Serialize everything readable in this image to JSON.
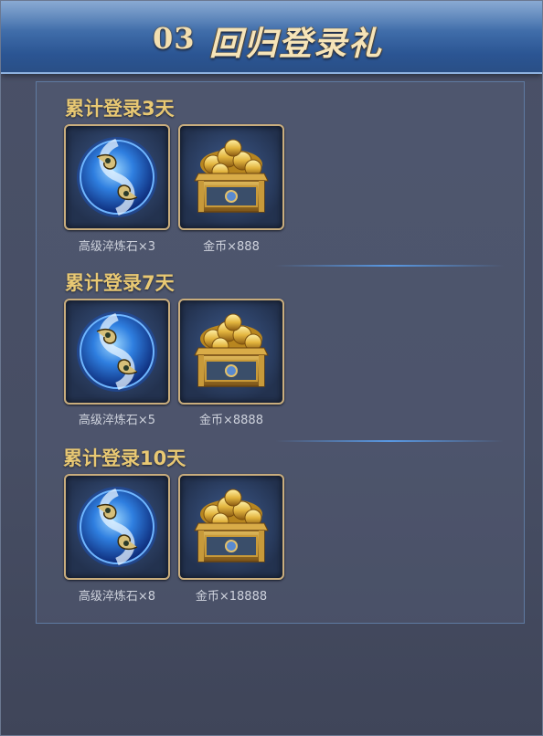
{
  "header": {
    "number": "03",
    "title": "回归登录礼"
  },
  "sections": [
    {
      "title": "累计登录3天",
      "items": [
        {
          "icon": "gem-icon",
          "label": "高级淬炼石×3"
        },
        {
          "icon": "gold-chest-icon",
          "label": "金币×888"
        }
      ]
    },
    {
      "title": "累计登录7天",
      "items": [
        {
          "icon": "gem-icon",
          "label": "高级淬炼石×5"
        },
        {
          "icon": "gold-chest-icon",
          "label": "金币×8888"
        }
      ]
    },
    {
      "title": "累计登录10天",
      "items": [
        {
          "icon": "gem-icon",
          "label": "高级淬炼石×8"
        },
        {
          "icon": "gold-chest-icon",
          "label": "金币×18888"
        }
      ]
    }
  ]
}
